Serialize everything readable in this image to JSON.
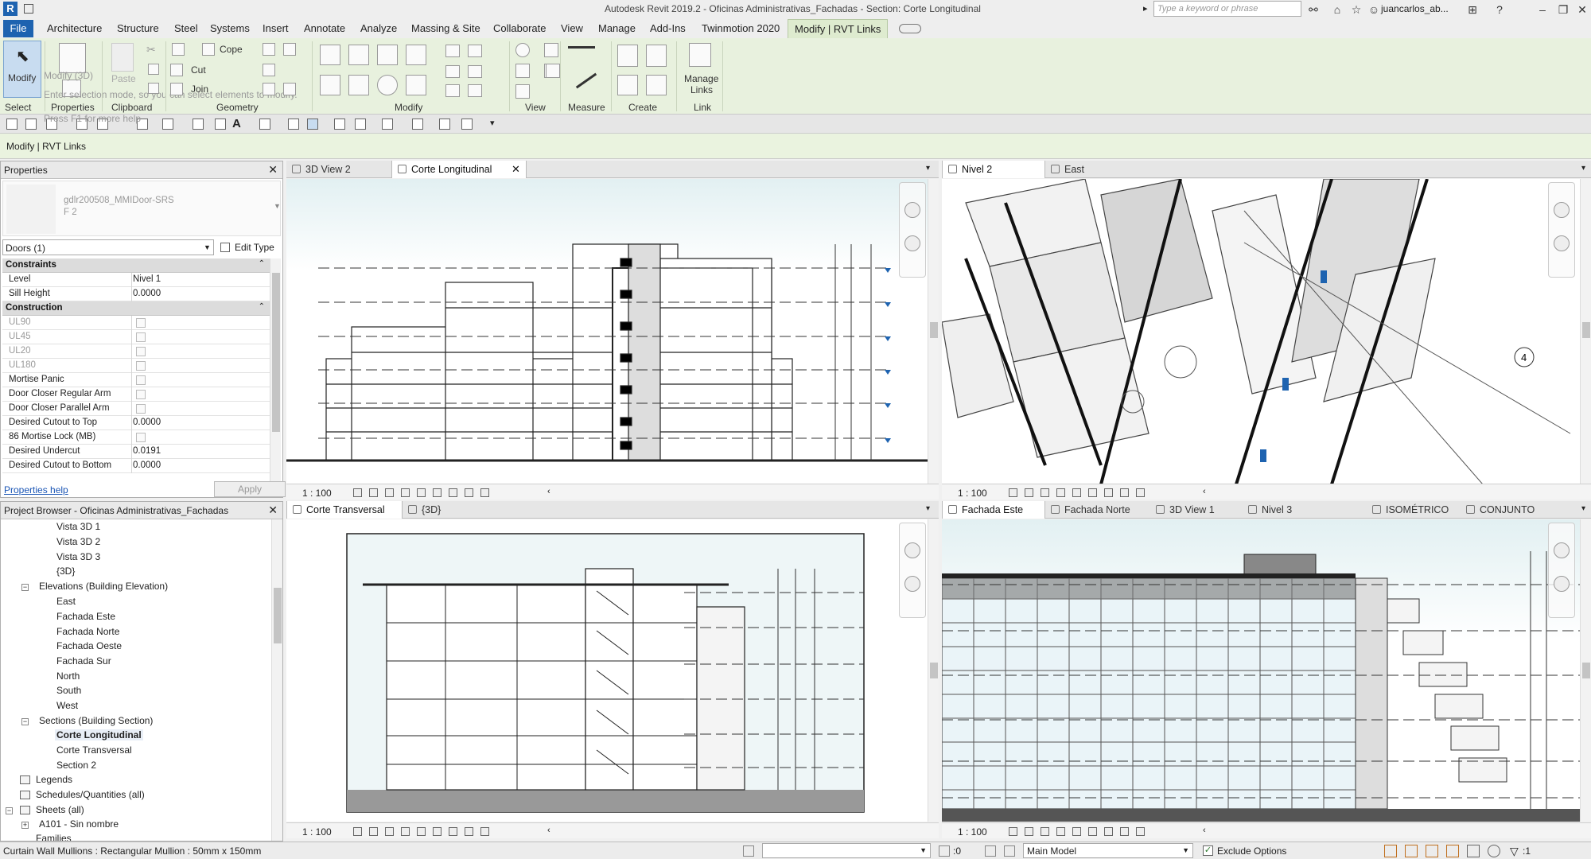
{
  "titlebar": {
    "title": "Autodesk Revit 2019.2 - Oficinas Administrativas_Fachadas - Section: Corte Longitudinal",
    "search_placeholder": "Type a keyword or phrase",
    "user": "juancarlos_ab...",
    "app_letter": "R"
  },
  "menu": {
    "file": "File",
    "items": [
      "Architecture",
      "Structure",
      "Steel",
      "Systems",
      "Insert",
      "Annotate",
      "Analyze",
      "Massing & Site",
      "Collaborate",
      "View",
      "Manage",
      "Add-Ins",
      "Twinmotion 2020"
    ],
    "active": "Modify | RVT Links"
  },
  "ribbon": {
    "modify": "Modify",
    "select": "Select",
    "properties": "Properties",
    "clipboard": "Clipboard",
    "paste": "Paste",
    "cope": "Cope",
    "cut": "Cut",
    "join": "Join",
    "geometry": "Geometry",
    "modify_panel": "Modify",
    "view": "View",
    "measure": "Measure",
    "create": "Create",
    "manage_links_1": "Manage",
    "manage_links_2": "Links",
    "link": "Link",
    "tooltip_line1": "Modify (3D)",
    "tooltip_line2": "Enter selection mode, so you can select elements to modify.",
    "tooltip_line3": "Press F1 for more help"
  },
  "context_bar": "Modify | RVT Links",
  "properties": {
    "header": "Properties",
    "type_name": "gdlr200508_MMIDoor-SRS",
    "type_sub": "F 2",
    "filter": "Doors (1)",
    "edit_type": "Edit Type",
    "groups": [
      {
        "name": "Constraints"
      },
      {
        "name": "Construction"
      }
    ],
    "rows": [
      {
        "k": "Level",
        "v": "Nivel 1"
      },
      {
        "k": "Sill Height",
        "v": "0.0000"
      },
      {
        "k": "UL90",
        "v": ""
      },
      {
        "k": "UL45",
        "v": ""
      },
      {
        "k": "UL20",
        "v": ""
      },
      {
        "k": "UL180",
        "v": ""
      },
      {
        "k": "Mortise Panic",
        "v": ""
      },
      {
        "k": "Door Closer Regular Arm",
        "v": ""
      },
      {
        "k": "Door Closer Parallel Arm",
        "v": ""
      },
      {
        "k": "Desired Cutout to Top",
        "v": "0.0000"
      },
      {
        "k": "86 Mortise Lock (MB)",
        "v": ""
      },
      {
        "k": "Desired Undercut",
        "v": "0.0191"
      },
      {
        "k": "Desired Cutout to Bottom",
        "v": "0.0000"
      }
    ],
    "help": "Properties help",
    "apply": "Apply"
  },
  "browser": {
    "header": "Project Browser - Oficinas Administrativas_Fachadas",
    "items": [
      {
        "label": "Vista 3D 1"
      },
      {
        "label": "Vista 3D 2"
      },
      {
        "label": "Vista 3D 3"
      },
      {
        "label": "{3D}"
      },
      {
        "label": "Elevations (Building Elevation)"
      },
      {
        "label": "East"
      },
      {
        "label": "Fachada Este"
      },
      {
        "label": "Fachada Norte"
      },
      {
        "label": "Fachada Oeste"
      },
      {
        "label": "Fachada Sur"
      },
      {
        "label": "North"
      },
      {
        "label": "South"
      },
      {
        "label": "West"
      },
      {
        "label": "Sections (Building Section)"
      },
      {
        "label": "Corte Longitudinal"
      },
      {
        "label": "Corte Transversal"
      },
      {
        "label": "Section 2"
      },
      {
        "label": "Legends"
      },
      {
        "label": "Schedules/Quantities (all)"
      },
      {
        "label": "Sheets (all)"
      },
      {
        "label": "A101 - Sin nombre"
      },
      {
        "label": "Families"
      }
    ]
  },
  "views": {
    "tl_tabs": [
      "3D View 2",
      "Corte Longitudinal"
    ],
    "tr_tabs": [
      "Nivel 2",
      "East"
    ],
    "bl_tabs": [
      "Corte Transversal",
      "{3D}"
    ],
    "br_tabs": [
      "Fachada Este",
      "Fachada Norte",
      "3D View 1",
      "Nivel 3",
      "ISOMÉTRICO",
      "CONJUNTO"
    ],
    "scale": "1 : 100",
    "grid_bubble": "4"
  },
  "status": {
    "left": "Curtain Wall Mullions : Rectangular Mullion : 50mm x 150mm",
    "zero": ":0",
    "model": "Main Model",
    "exclude": "Exclude Options",
    "filter_count": ":1"
  }
}
